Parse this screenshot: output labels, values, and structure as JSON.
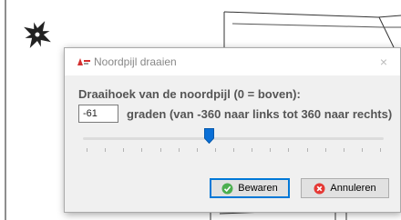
{
  "dialog": {
    "title": "Noordpijl draaien",
    "close_symbol": "×",
    "prompt": "Draaihoek van de noordpijl (0 = boven):",
    "angle_value": "-61",
    "range_hint": "graden (van -360 naar links tot 360 naar rechts)",
    "slider": {
      "min": -360,
      "max": 360,
      "value": -61,
      "tick_count": 17
    },
    "save_label": "Bewaren",
    "cancel_label": "Annuleren"
  },
  "icons": {
    "app": "app-logo-icon",
    "compass": "north-arrow-icon",
    "save": "check-circle-icon",
    "cancel": "cross-circle-icon"
  },
  "colors": {
    "save_icon": "#4caf50",
    "cancel_icon": "#e53935",
    "slider_thumb": "#0a6fd6",
    "focus_border": "#0078d7"
  }
}
